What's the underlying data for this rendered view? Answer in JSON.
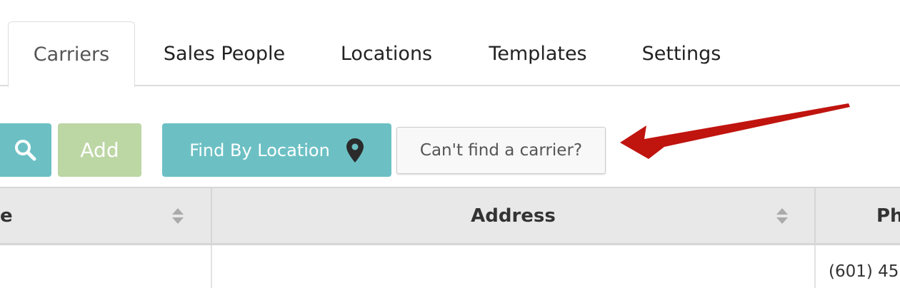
{
  "tabs": [
    {
      "label": "Carriers",
      "active": true
    },
    {
      "label": "Sales People",
      "active": false
    },
    {
      "label": "Locations",
      "active": false
    },
    {
      "label": "Templates",
      "active": false
    },
    {
      "label": "Settings",
      "active": false
    }
  ],
  "toolbar": {
    "search_icon": "search-icon",
    "add_label": "Add",
    "find_label": "Find By Location",
    "find_icon": "map-marker-icon",
    "cant_find_label": "Can't find a carrier?"
  },
  "table": {
    "columns": [
      {
        "label": "e",
        "sortable": true
      },
      {
        "label": "Address",
        "sortable": true
      },
      {
        "label": "Ph",
        "sortable": false
      }
    ],
    "rows": [
      {
        "name": "",
        "address": "",
        "phone": "(601) 45"
      }
    ]
  },
  "colors": {
    "teal": "#6cc0c4",
    "green_disabled": "#bcd6a4",
    "header_bg": "#e8e8e8",
    "annotation_red": "#c0140f"
  }
}
